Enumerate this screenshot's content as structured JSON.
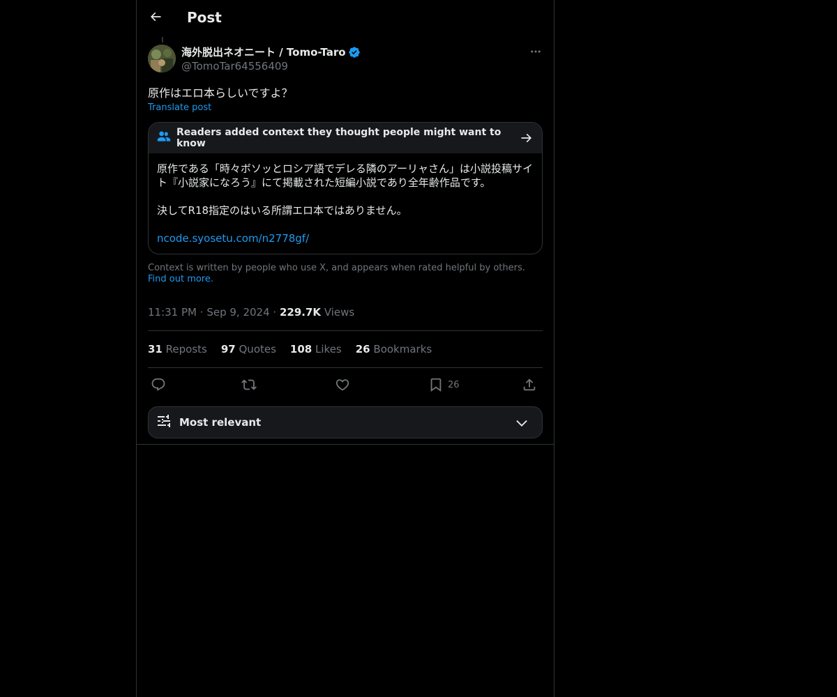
{
  "header": {
    "title": "Post",
    "back_icon": "arrow-left-icon"
  },
  "post": {
    "author": {
      "display_name": "海外脱出ネオニート / Tomo-Taro",
      "handle": "@TomoTar64556409",
      "verified": true
    },
    "text": "原作はエロ本らしいですよ？",
    "translate_label": "Translate post"
  },
  "community_note": {
    "header": "Readers added context they thought people might want to know",
    "body_p1": "原作である「時々ボソッとロシア語でデレる隣のアーリャさん」は小説投稿サイト『小説家になろう』にて掲載された短編小説であり全年齢作品です。",
    "body_p2": "決してR18指定のはいる所謂エロ本ではありません。",
    "link": "ncode.syosetu.com/n2778gf/",
    "footer_text": "Context is written by people who use X, and appears when rated helpful by others.",
    "footer_link": "Find out more."
  },
  "meta": {
    "time": "11:31 PM",
    "date": "Sep 9, 2024",
    "dot": "·",
    "views_count": "229.7K",
    "views_label": "Views"
  },
  "stats": {
    "reposts_count": "31",
    "reposts_label": "Reposts",
    "quotes_count": "97",
    "quotes_label": "Quotes",
    "likes_count": "108",
    "likes_label": "Likes",
    "bookmarks_count": "26",
    "bookmarks_label": "Bookmarks"
  },
  "actions": {
    "bookmark_count": "26"
  },
  "replies_filter": {
    "label": "Most relevant"
  },
  "colors": {
    "background": "#000000",
    "text": "#e7e9ea",
    "muted": "#71767b",
    "accent": "#1d9bf0",
    "border": "#2f3336",
    "note_header_bg": "#16181c"
  }
}
